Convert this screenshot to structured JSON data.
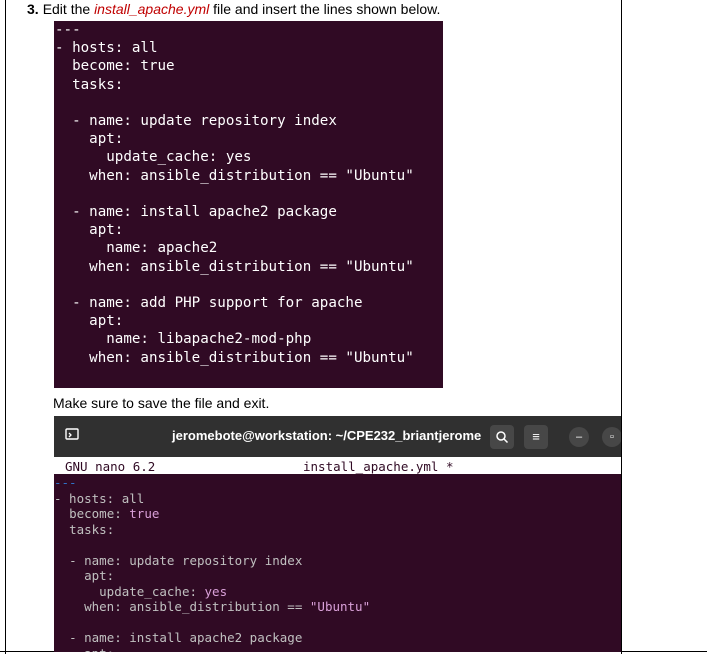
{
  "instruction": {
    "number": "3.",
    "before": "Edit the ",
    "file": "install_apache.yml",
    "after": " file and insert the lines shown below."
  },
  "code_lines": [
    "---",
    "- hosts: all",
    "  become: true",
    "  tasks:",
    "",
    "  - name: update repository index",
    "    apt:",
    "      update_cache: yes",
    "    when: ansible_distribution == \"Ubuntu\"",
    "",
    "  - name: install apache2 package",
    "    apt:",
    "      name: apache2",
    "    when: ansible_distribution == \"Ubuntu\"",
    "",
    "  - name: add PHP support for apache",
    "    apt:",
    "      name: libapache2-mod-php",
    "    when: ansible_distribution == \"Ubuntu\""
  ],
  "note": "Make sure to save the file and exit.",
  "terminal": {
    "title": "jeromebote@workstation: ~/CPE232_briantjerome",
    "nano_version": "GNU nano 6.2",
    "filename": "install_apache.yml *",
    "icons": [
      "terminal-icon",
      "search-icon",
      "menu-icon",
      "minimize-icon",
      "maximize-icon"
    ]
  }
}
